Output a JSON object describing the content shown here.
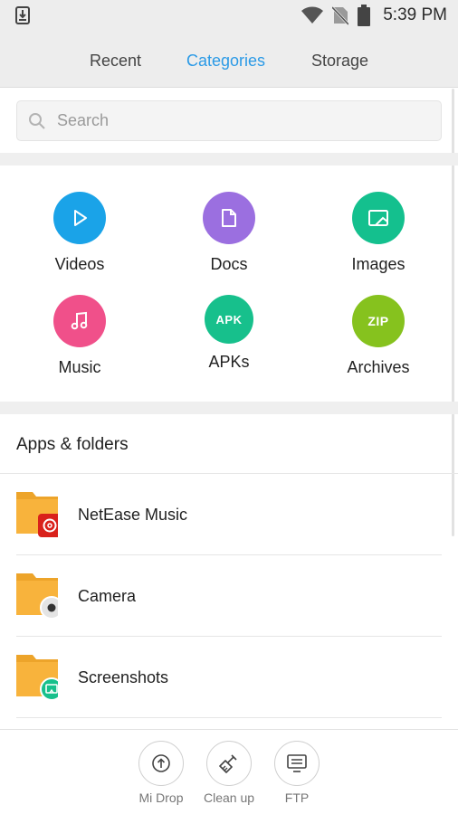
{
  "status_bar": {
    "time": "5:39 PM",
    "icons": [
      "download-icon",
      "wifi-icon",
      "no-sim-icon",
      "battery-icon"
    ]
  },
  "tabs": [
    {
      "label": "Recent",
      "active": false
    },
    {
      "label": "Categories",
      "active": true
    },
    {
      "label": "Storage",
      "active": false
    }
  ],
  "search": {
    "placeholder": "Search",
    "value": ""
  },
  "categories": [
    {
      "label": "Videos",
      "icon": "play-icon",
      "color": "#1aa3e8"
    },
    {
      "label": "Docs",
      "icon": "document-icon",
      "color": "#9b6fe0"
    },
    {
      "label": "Images",
      "icon": "image-icon",
      "color": "#14c08e"
    },
    {
      "label": "Music",
      "icon": "music-note-icon",
      "color": "#f0508a"
    },
    {
      "label": "APKs",
      "icon": "apk-icon",
      "badge": "APK",
      "color": "#17c08c"
    },
    {
      "label": "Archives",
      "icon": "zip-icon",
      "badge": "ZIP",
      "color": "#86c21e"
    }
  ],
  "apps_folders": {
    "title": "Apps & folders",
    "items": [
      {
        "name": "NetEase Music",
        "badge_icon": "netease-music-icon",
        "badge_color": "#d9211b"
      },
      {
        "name": "Camera",
        "badge_icon": "camera-icon",
        "badge_color": "#e0e0e0"
      },
      {
        "name": "Screenshots",
        "badge_icon": "screenshot-icon",
        "badge_color": "#17c08c"
      }
    ]
  },
  "bottom_tools": [
    {
      "label": "Mi Drop",
      "icon": "upload-circle-icon"
    },
    {
      "label": "Clean up",
      "icon": "broom-icon"
    },
    {
      "label": "FTP",
      "icon": "ftp-computer-icon"
    }
  ],
  "colors": {
    "accent": "#2b9ae6",
    "folder": "#f8b33c",
    "folder_tab": "#eda42a"
  }
}
